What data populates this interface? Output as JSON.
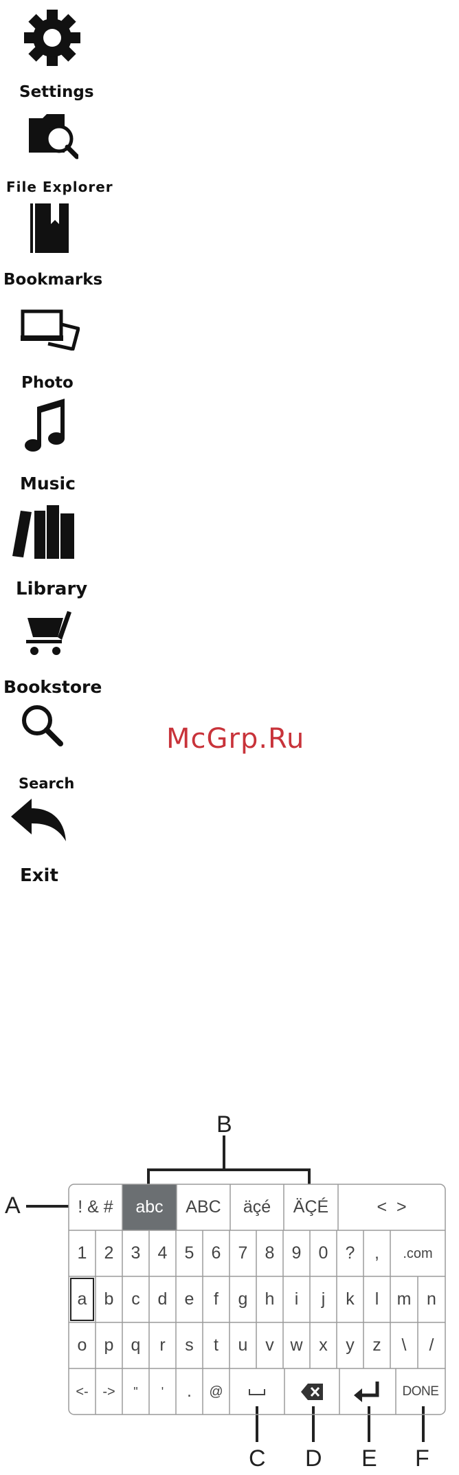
{
  "menu": {
    "items": [
      {
        "id": "settings",
        "label": "Settings",
        "icon": "gear-icon"
      },
      {
        "id": "file-explorer",
        "label": "File Explorer",
        "icon": "folder-search-icon"
      },
      {
        "id": "bookmarks",
        "label": "Bookmarks",
        "icon": "bookmark-icon"
      },
      {
        "id": "photo",
        "label": "Photo",
        "icon": "photo-icon"
      },
      {
        "id": "music",
        "label": "Music",
        "icon": "music-note-icon"
      },
      {
        "id": "library",
        "label": "Library",
        "icon": "books-icon"
      },
      {
        "id": "bookstore",
        "label": "Bookstore",
        "icon": "shopping-cart-icon"
      },
      {
        "id": "search",
        "label": "Search",
        "icon": "search-icon"
      },
      {
        "id": "exit",
        "label": "Exit",
        "icon": "back-arrow-icon"
      }
    ]
  },
  "watermark": "McGrp.Ru",
  "keyboard": {
    "modes": [
      "! & #",
      "abc",
      "ABC",
      "äçé",
      "ÄÇÉ"
    ],
    "active_mode": "abc",
    "cursor_keys": "<  >",
    "rows": [
      [
        "1",
        "2",
        "3",
        "4",
        "5",
        "6",
        "7",
        "8",
        "9",
        "0",
        "?",
        ",",
        ".com"
      ],
      [
        "a",
        "b",
        "c",
        "d",
        "e",
        "f",
        "g",
        "h",
        "i",
        "j",
        "k",
        "l",
        "m",
        "n"
      ],
      [
        "o",
        "p",
        "q",
        "r",
        "s",
        "t",
        "u",
        "v",
        "w",
        "x",
        "y",
        "z",
        "\\",
        "/"
      ],
      [
        "<-",
        "->",
        "\"",
        "'",
        ".",
        "@"
      ]
    ],
    "selected_key": "a",
    "space_icon": "space-bar-icon",
    "backspace_icon": "backspace-icon",
    "enter_icon": "enter-icon",
    "done_label": "DONE"
  },
  "callouts": {
    "A": "A",
    "B": "B",
    "C": "C",
    "D": "D",
    "E": "E",
    "F": "F"
  }
}
